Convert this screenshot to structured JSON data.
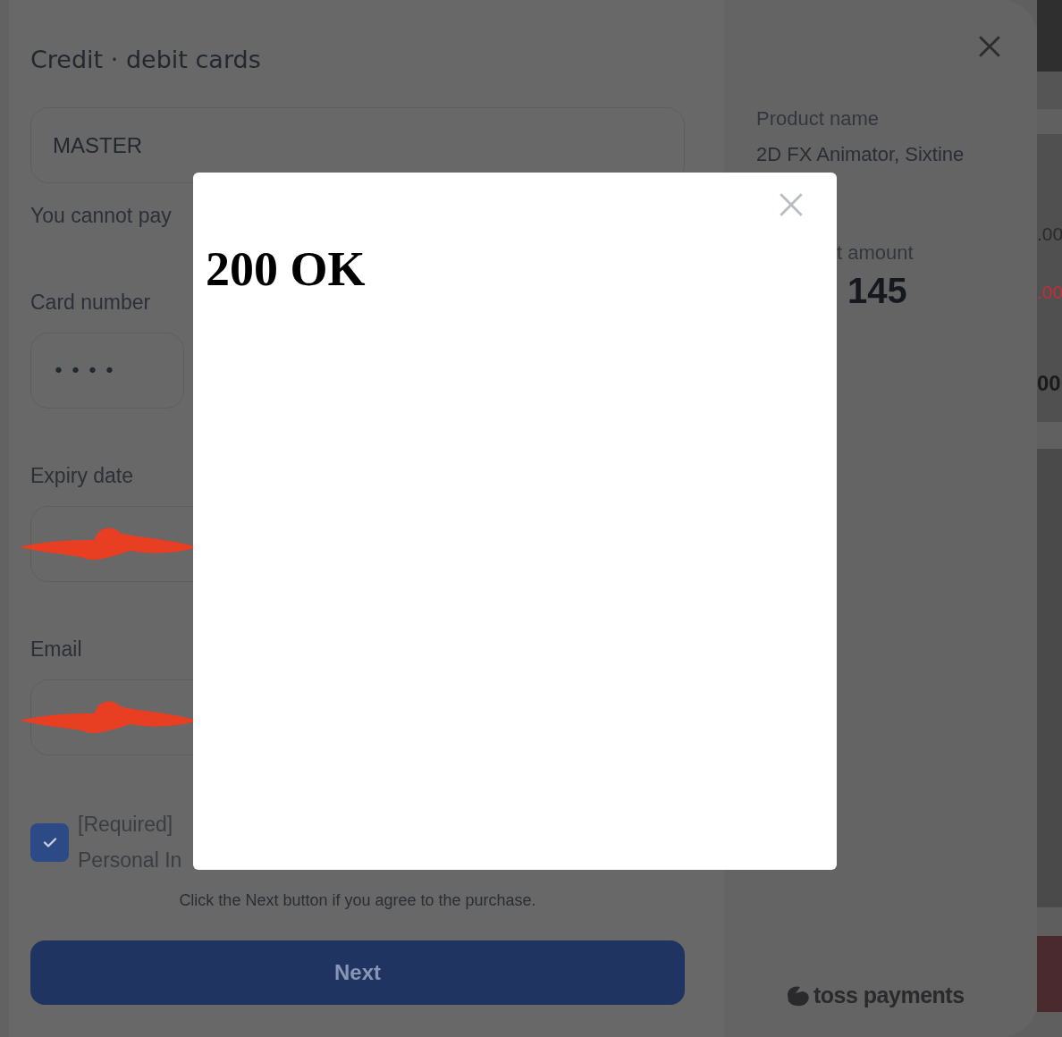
{
  "dialog": {
    "title": "Credit · debit cards",
    "card_type": "MASTER",
    "notice": "You cannot pay",
    "fields": [
      {
        "label": "Card number",
        "kind": "masked",
        "value": "••••"
      },
      {
        "label": "Expiry date",
        "kind": "redacted"
      },
      {
        "label": "Email",
        "kind": "redacted"
      }
    ],
    "consent": {
      "checked": true,
      "lines": [
        "[Required]",
        "Personal In"
      ]
    },
    "hint": "Click the Next button if you agree to the purchase.",
    "next_button": "Next"
  },
  "summary": {
    "product_label": "Product name",
    "product_name": "2D FX Animator, Sixtine",
    "amount_label": "t amount",
    "amount": "145",
    "brand": "toss payments"
  },
  "background_page": {
    "texts": [
      {
        "text": ".00",
        "kind": "normal"
      },
      {
        "text": ".00",
        "kind": "negative"
      },
      {
        "text": "00",
        "kind": "large"
      }
    ]
  },
  "response_modal": {
    "heading": "200 OK"
  }
}
